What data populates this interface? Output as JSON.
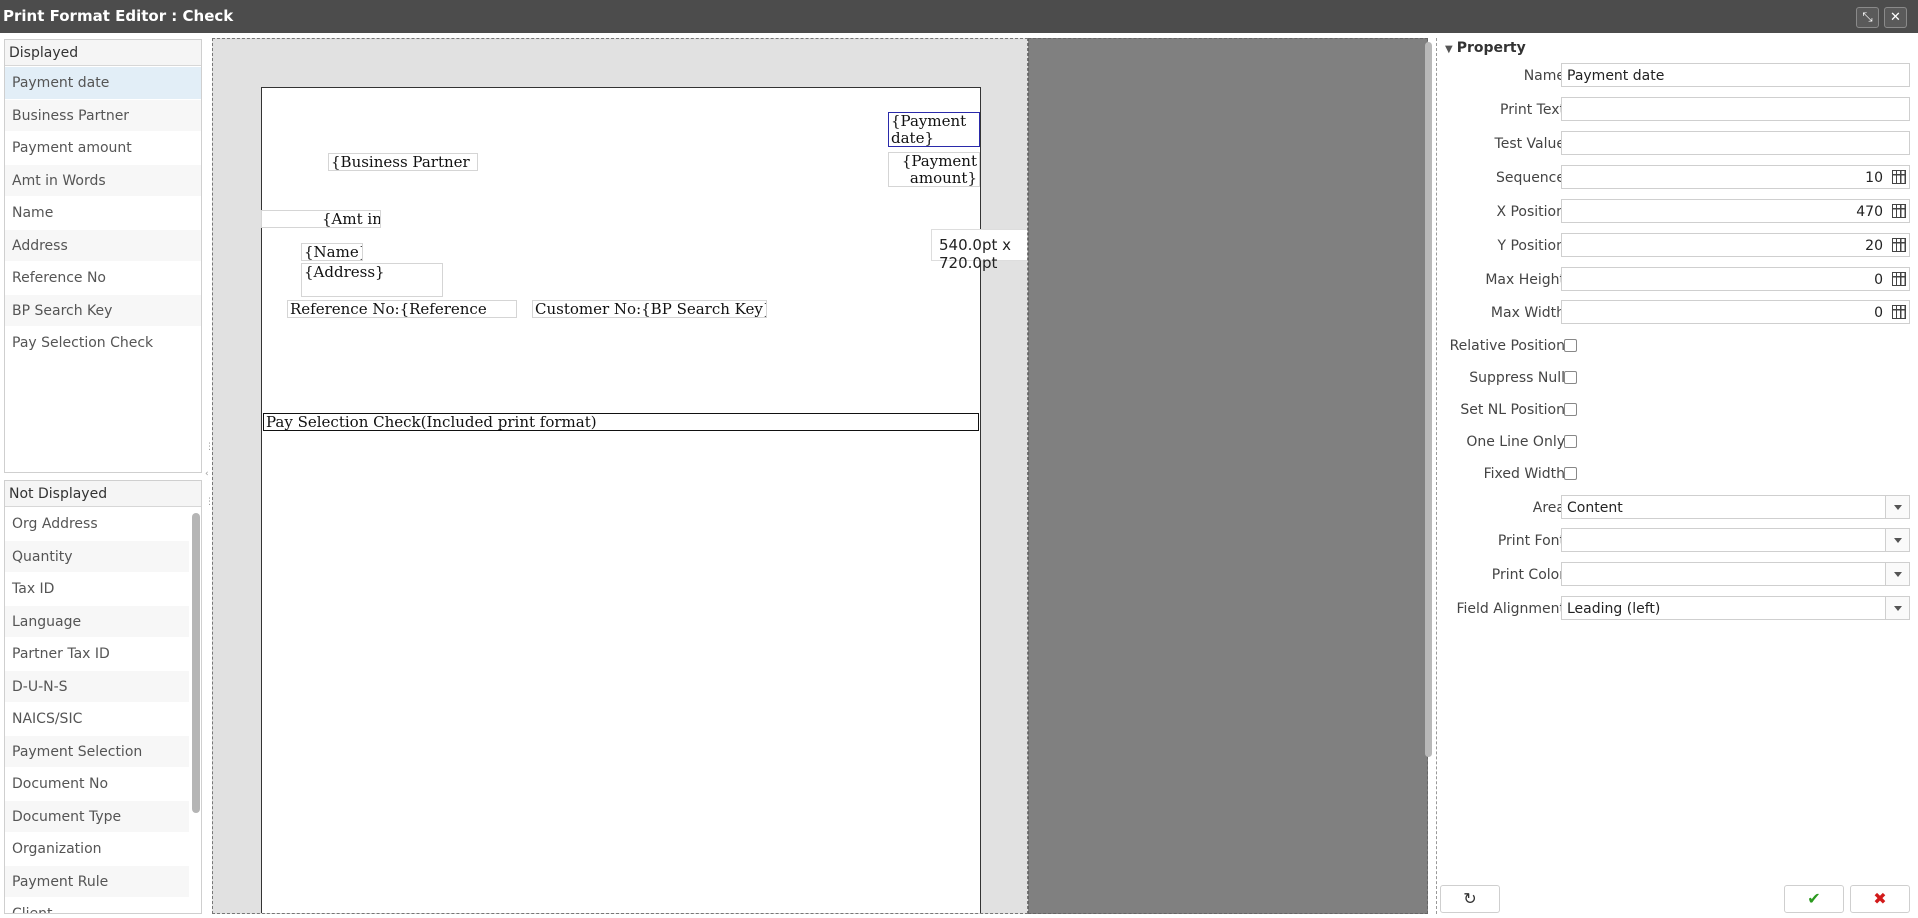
{
  "window": {
    "title": "Print Format Editor : Check"
  },
  "displayed": {
    "header": "Displayed",
    "items": [
      "Payment date",
      "Business Partner",
      "Payment amount",
      "Amt in Words",
      "Name",
      "Address",
      "Reference No",
      "BP Search Key",
      "Pay Selection Check"
    ]
  },
  "not_displayed": {
    "header": "Not Displayed",
    "items": [
      "Org Address",
      "Quantity",
      "Tax ID",
      "Language",
      "Partner Tax ID",
      "D-U-N-S",
      "NAICS/SIC",
      "Payment Selection",
      "Document No",
      "Document Type",
      "Organization",
      "Payment Rule",
      "Client"
    ]
  },
  "canvas": {
    "size_label": "540.0pt x 720.0pt",
    "fields": {
      "payment_date": "{Payment date}",
      "payment_amount": "{Payment amount}",
      "business_partner": "{Business Partner",
      "amt_in_words": "{Amt in",
      "name": "{Name}",
      "address": "{Address}",
      "reference_no": "Reference No:{Reference",
      "customer_no": "Customer No:{BP Search Key}",
      "pay_selection_check": "Pay Selection Check(Included print format)"
    }
  },
  "properties": {
    "header": "Property",
    "name": {
      "label": "Name",
      "value": "Payment date"
    },
    "print_text": {
      "label": "Print Text",
      "value": ""
    },
    "test_value": {
      "label": "Test Value",
      "value": ""
    },
    "sequence": {
      "label": "Sequence",
      "value": "10"
    },
    "x_position": {
      "label": "X Position",
      "value": "470"
    },
    "y_position": {
      "label": "Y Position",
      "value": "20"
    },
    "max_height": {
      "label": "Max Height",
      "value": "0"
    },
    "max_width": {
      "label": "Max Width",
      "value": "0"
    },
    "relative_position": {
      "label": "Relative Position",
      "checked": false
    },
    "suppress_null": {
      "label": "Suppress Null",
      "checked": false
    },
    "set_nl_position": {
      "label": "Set NL Position",
      "checked": false
    },
    "one_line_only": {
      "label": "One Line Only",
      "checked": false
    },
    "fixed_width": {
      "label": "Fixed Width",
      "checked": false
    },
    "area": {
      "label": "Area",
      "value": "Content"
    },
    "print_font": {
      "label": "Print Font",
      "value": ""
    },
    "print_color": {
      "label": "Print Color",
      "value": ""
    },
    "field_alignment": {
      "label": "Field Alignment",
      "value": "Leading (left)"
    }
  },
  "icons": {
    "maximize": "maximize-icon",
    "close": "close-icon",
    "refresh": "refresh-icon",
    "ok": "check-icon",
    "cancel": "x-icon"
  },
  "colors": {
    "titlebar": "#4c4c4c",
    "selected_row": "#e2eef7",
    "selected_field_border": "#2a2aaa",
    "ok": "#2b9a1f",
    "cancel": "#d21a1a"
  }
}
